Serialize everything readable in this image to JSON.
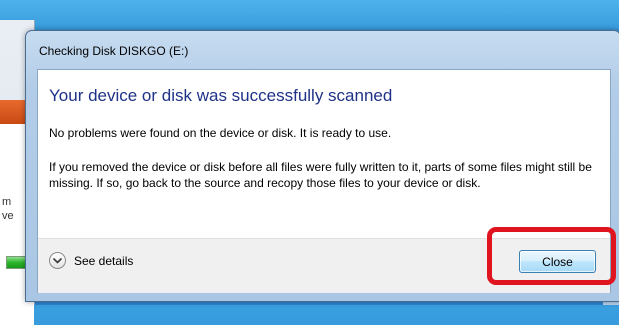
{
  "background": {
    "left_window_text": [
      "m",
      "ve"
    ]
  },
  "dialog": {
    "title": "Checking Disk DISKGO (E:)",
    "main_instruction": "Your device or disk was successfully scanned",
    "message_1": "No problems were found on the device or disk. It is ready to use.",
    "message_2": "If you removed the device or disk before all files were fully written to it, parts of some files might still be missing. If so, go back to the source and recopy those files to your device or disk.",
    "details_label": "See details",
    "close_label": "Close"
  },
  "colors": {
    "main_instruction": "#1e3287",
    "highlight": "#e0141e",
    "desktop": "#2a84cf"
  },
  "icons": {
    "details_toggle": "chevron-down-circle-icon"
  }
}
